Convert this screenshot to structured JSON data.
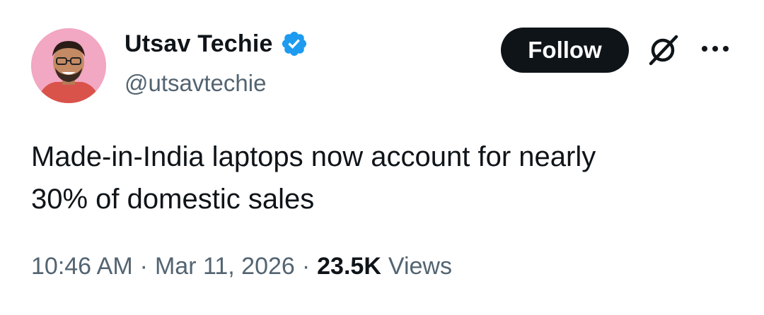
{
  "author": {
    "display_name": "Utsav Techie",
    "handle": "@utsavtechie",
    "verified": true,
    "verified_color": "#1d9bf0",
    "avatar_background": "#f2a7c3"
  },
  "actions": {
    "follow_label": "Follow",
    "grok_icon": "grok-icon",
    "more_icon": "more-options-icon"
  },
  "tweet": {
    "text_lines": [
      "Made-in-India laptops now account for nearly",
      "30% of domestic sales"
    ]
  },
  "meta": {
    "time": "10:46 AM",
    "separator": "·",
    "date": "Mar 11, 2026",
    "views_count": "23.5K",
    "views_label": "Views"
  },
  "colors": {
    "text_primary": "#0f1419",
    "text_secondary": "#536471",
    "button_bg": "#0f1419"
  }
}
